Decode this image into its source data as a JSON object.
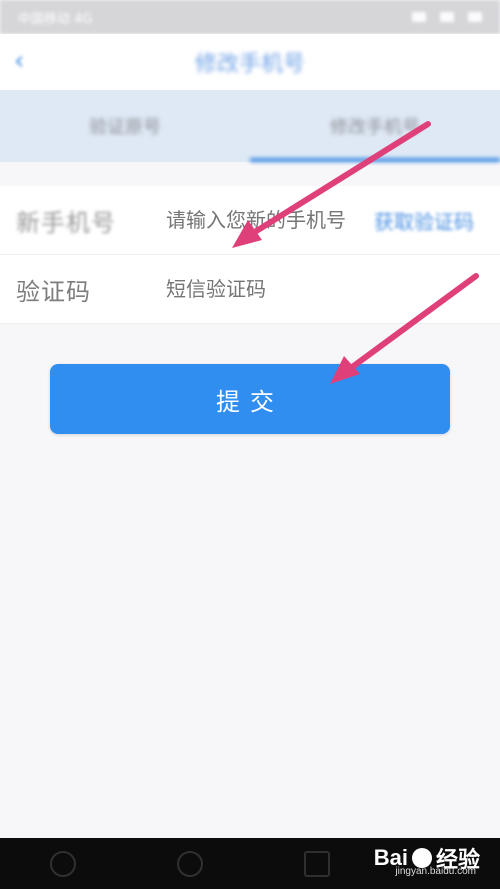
{
  "status_bar": {
    "left_text": "中国移动 4G"
  },
  "nav": {
    "title": "修改手机号",
    "back_icon": "chevron-left-icon"
  },
  "tabs": [
    {
      "label": "验证原号"
    },
    {
      "label": "修改手机号"
    }
  ],
  "form": {
    "phone_label": "新手机号",
    "phone_placeholder": "请输入您新的手机号",
    "get_code_label": "获取验证码",
    "code_label": "验证码",
    "code_placeholder": "短信验证码"
  },
  "submit_label": "提交",
  "watermark": {
    "brand": "Bai",
    "brand2": "经验",
    "site": "jingyan.baidu.com"
  },
  "colors": {
    "accent": "#2f8ef0",
    "arrow": "#e0407a"
  }
}
